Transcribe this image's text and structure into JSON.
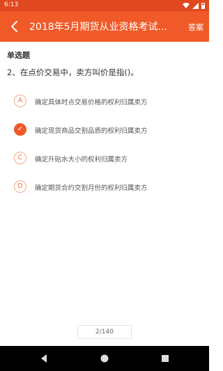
{
  "status_bar": {
    "time": "6:13"
  },
  "app_bar": {
    "title": "2018年5月期货从业资格考试...",
    "answer_label": "答案"
  },
  "question": {
    "type": "单选题",
    "text": "2、在点价交易中，卖方叫价是指()。",
    "options": [
      {
        "letter": "A",
        "text": "确定具体时点交易价格的权利归属卖方",
        "selected": false
      },
      {
        "letter": "✓",
        "text": "确定现货商品交割品质的权利归属卖方",
        "selected": true
      },
      {
        "letter": "C",
        "text": "确定升贴水大小的权利归属卖方",
        "selected": false
      },
      {
        "letter": "D",
        "text": "确定期货合约交割月份的权利归属卖方",
        "selected": false
      }
    ]
  },
  "pager": {
    "text": "2/140"
  },
  "colors": {
    "accent": "#f05a28",
    "status": "#e0481f"
  },
  "icons": {
    "back": "chevron-left-icon",
    "nav": [
      "nav-back-icon",
      "nav-home-icon",
      "nav-recent-icon"
    ]
  }
}
